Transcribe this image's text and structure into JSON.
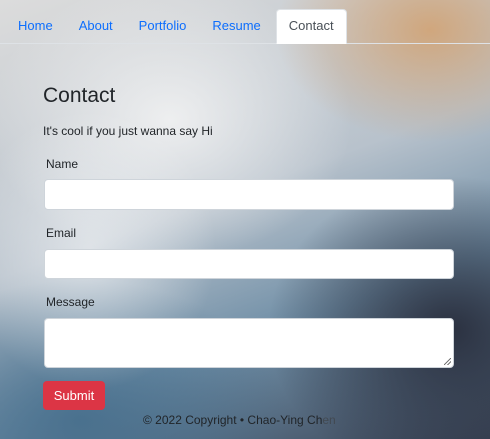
{
  "nav": {
    "items": [
      {
        "label": "Home"
      },
      {
        "label": "About"
      },
      {
        "label": "Portfolio"
      },
      {
        "label": "Resume"
      },
      {
        "label": "Contact"
      }
    ],
    "active": "Contact"
  },
  "contact": {
    "title": "Contact",
    "subtitle": "It's cool if you just wanna say Hi",
    "name_label": "Name",
    "name_value": "",
    "email_label": "Email",
    "email_value": "",
    "message_label": "Message",
    "message_value": "",
    "submit_label": "Submit"
  },
  "footer": {
    "text": "© 2022 Copyright • Chao-Ying Ch",
    "faded_text": "en"
  },
  "colors": {
    "link": "#0d6efd",
    "submit": "#dc3545"
  }
}
